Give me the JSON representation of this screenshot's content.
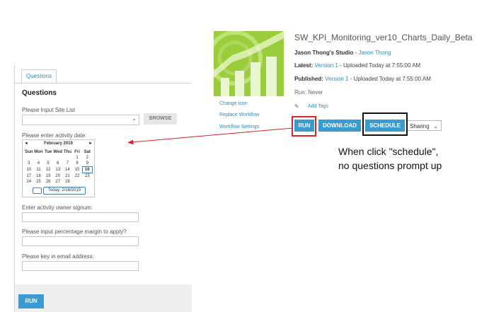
{
  "questions_panel": {
    "tab_label": "Questions",
    "title": "Questions",
    "site_list_label": "Please Input Site List",
    "browse_label": "BROWSE",
    "activity_date_label": "Please enter activity date:",
    "calendar": {
      "month_label": "February 2019",
      "prev_glyph": "◄",
      "next_glyph": "►",
      "weekdays": [
        "Sun",
        "Mon",
        "Tue",
        "Wed",
        "Thu",
        "Fri",
        "Sat"
      ],
      "weeks": [
        [
          "",
          "",
          "",
          "",
          "",
          "1",
          "2"
        ],
        [
          "3",
          "4",
          "5",
          "6",
          "7",
          "8",
          "9"
        ],
        [
          "10",
          "11",
          "12",
          "13",
          "14",
          "15",
          "16"
        ],
        [
          "17",
          "18",
          "19",
          "20",
          "21",
          "22",
          "23"
        ],
        [
          "24",
          "25",
          "26",
          "27",
          "28",
          "",
          ""
        ]
      ],
      "selected_day": "16",
      "today_label": "Today: 2/16/2019"
    },
    "owner_label": "Enter activity owner signum:",
    "margin_label": "Please input percentage margin to apply?",
    "email_label": "Please key in email address:",
    "run_label": "RUN"
  },
  "workflow": {
    "title": "SW_KPI_Monitoring_ver10_Charts_Daily_Beta",
    "studio": "Jason Thong's Studio",
    "studio_sep": " - ",
    "owner": "Jason Thong",
    "latest_label": "Latest:",
    "latest_version": "Version 1",
    "latest_suffix": " - Uploaded Today at 7:55:00 AM",
    "published_label": "Published:",
    "published_version": "Version 1",
    "published_suffix": " - Uploaded Today at 7:55:00 AM",
    "run_info": "Run: Never",
    "add_tags": "Add Tags",
    "change_icon": "Change Icon",
    "replace_workflow": "Replace Workflow",
    "workflow_settings": "Workflow Settings",
    "run_button": "RUN",
    "download_button": "DOWNLOAD",
    "schedule_button": "SCHEDULE",
    "sharing_label": "Sharing",
    "thumb_color": "#9acd3a"
  },
  "annotation": {
    "note": "When click \"schedule\", no questions prompt up",
    "red": "#d9222a"
  }
}
